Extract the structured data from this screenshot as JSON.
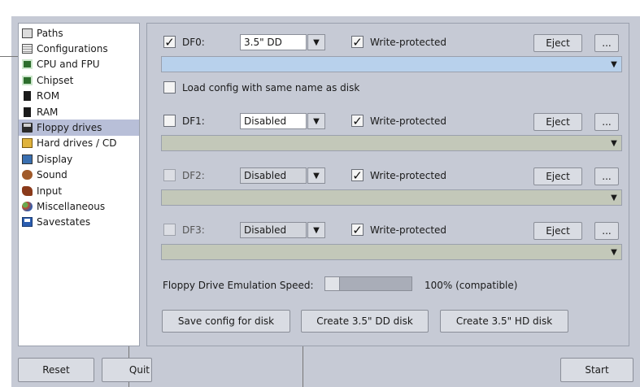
{
  "sidebar": {
    "items": [
      {
        "label": "Paths",
        "icon": "paths-icon"
      },
      {
        "label": "Configurations",
        "icon": "configurations-icon"
      },
      {
        "label": "CPU and FPU",
        "icon": "cpu-chip-icon"
      },
      {
        "label": "Chipset",
        "icon": "chipset-icon"
      },
      {
        "label": "ROM",
        "icon": "rom-icon"
      },
      {
        "label": "RAM",
        "icon": "ram-icon"
      },
      {
        "label": "Floppy drives",
        "icon": "floppy-icon",
        "active": true
      },
      {
        "label": "Hard drives / CD",
        "icon": "harddrive-icon"
      },
      {
        "label": "Display",
        "icon": "display-icon"
      },
      {
        "label": "Sound",
        "icon": "sound-icon"
      },
      {
        "label": "Input",
        "icon": "input-icon"
      },
      {
        "label": "Miscellaneous",
        "icon": "miscellaneous-icon"
      },
      {
        "label": "Savestates",
        "icon": "savestates-icon"
      }
    ]
  },
  "drives": {
    "df0": {
      "label": "DF0:",
      "type": "3.5\" DD",
      "enabled": true,
      "write_protected_label": "Write-protected",
      "write_protected": true,
      "eject": "Eject",
      "browse": "..."
    },
    "df1": {
      "label": "DF1:",
      "type": "Disabled",
      "enabled": false,
      "write_protected_label": "Write-protected",
      "write_protected": true,
      "eject": "Eject",
      "browse": "..."
    },
    "df2": {
      "label": "DF2:",
      "type": "Disabled",
      "enabled": false,
      "write_protected_label": "Write-protected",
      "write_protected": true,
      "eject": "Eject",
      "browse": "..."
    },
    "df3": {
      "label": "DF3:",
      "type": "Disabled",
      "enabled": false,
      "write_protected_label": "Write-protected",
      "write_protected": true,
      "eject": "Eject",
      "browse": "..."
    }
  },
  "load_config": {
    "label": "Load config with same name as disk",
    "checked": false
  },
  "speed": {
    "label": "Floppy Drive Emulation Speed:",
    "value_text": "100% (compatible)",
    "level": 0.0
  },
  "actions": {
    "save_config": "Save config for disk",
    "create_dd": "Create 3.5\" DD disk",
    "create_hd": "Create 3.5\" HD disk"
  },
  "footer": {
    "reset": "Reset",
    "quit": "Quit",
    "start": "Start"
  },
  "colors": {
    "window_bg": "#c6cad5",
    "active_item": "#b8bfd8",
    "selected_path": "#b8d1ec",
    "path_field": "#c3c8b9"
  }
}
